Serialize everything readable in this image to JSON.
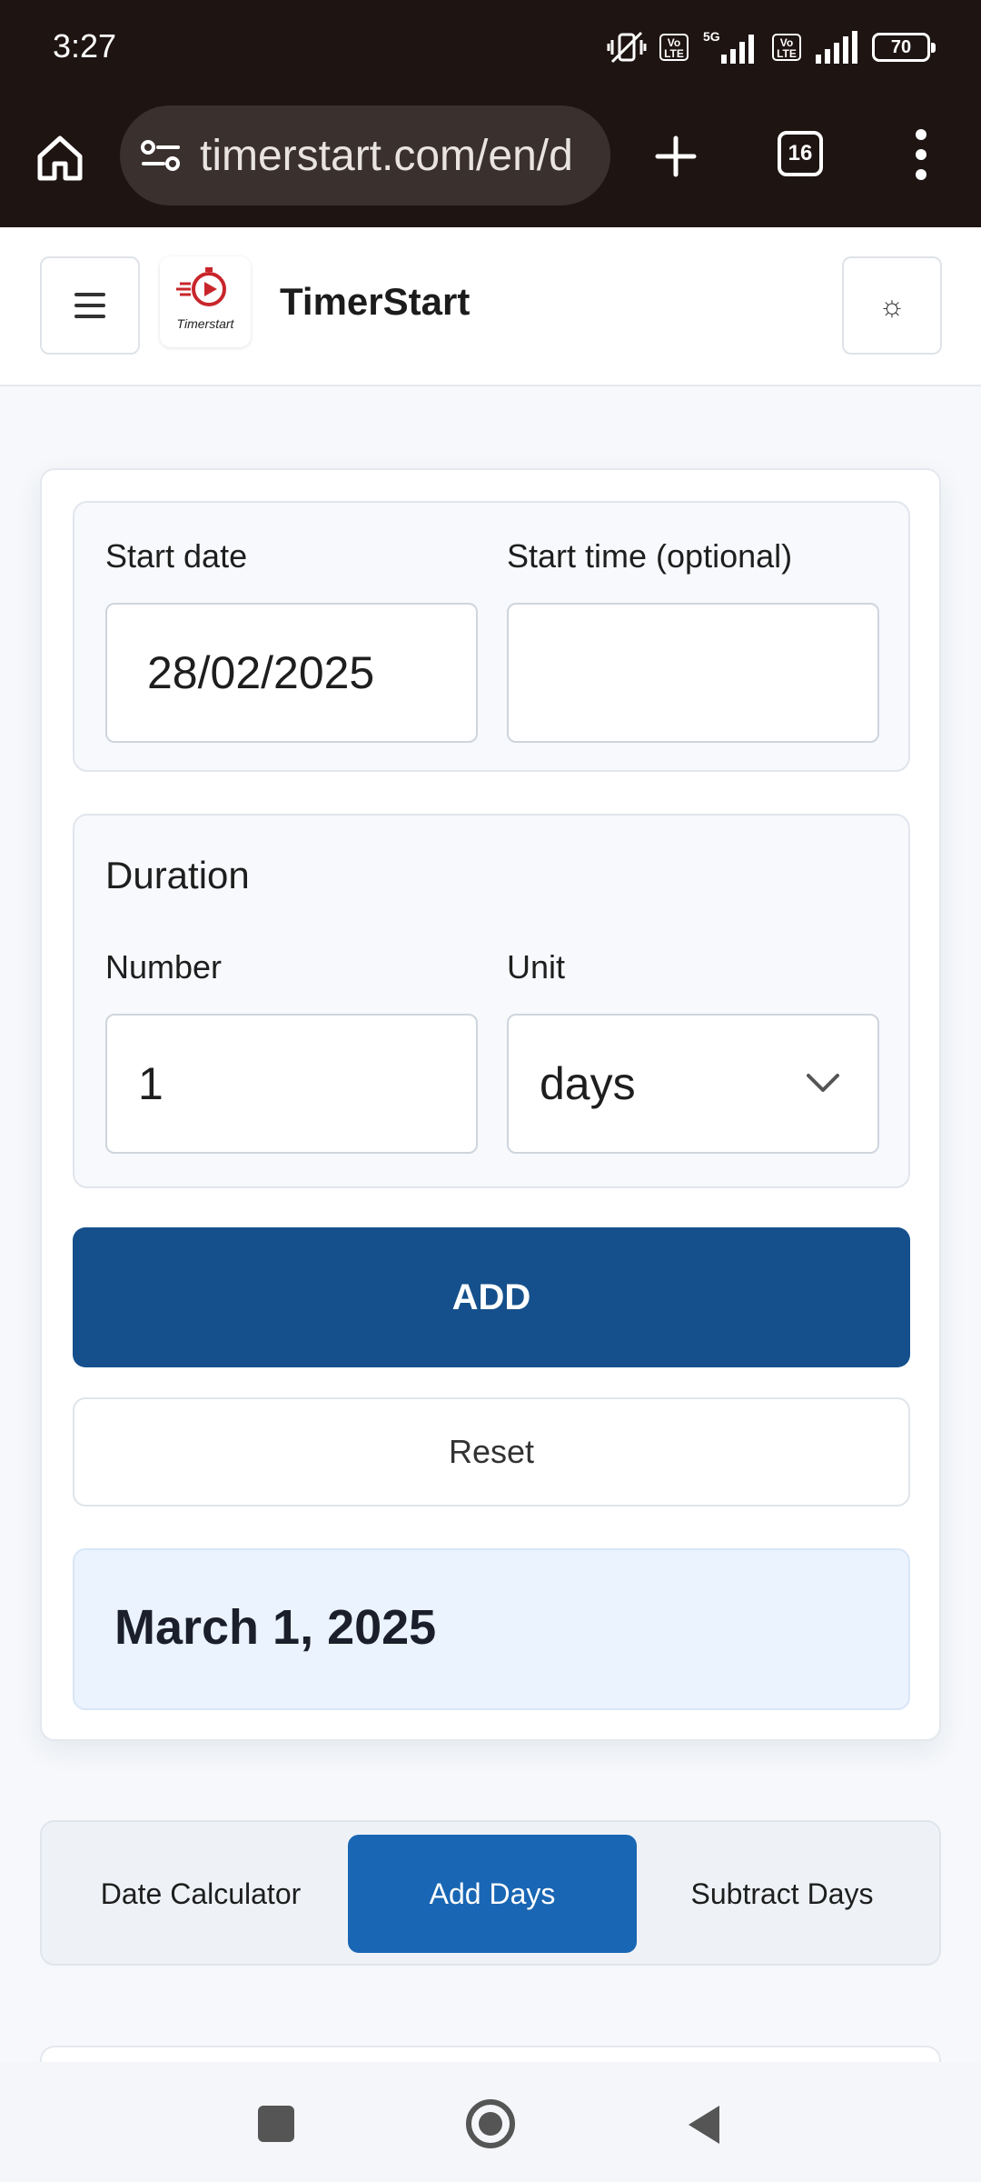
{
  "status_bar": {
    "time": "3:27",
    "network": "5G",
    "volte_label": "Vo LTE",
    "battery": "70"
  },
  "browser": {
    "url": "timerstart.com/en/d",
    "tab_count": "16"
  },
  "header": {
    "site_title": "TimerStart",
    "logo_text": "Timerstart",
    "theme_icon": "☼"
  },
  "form": {
    "start_date_label": "Start date",
    "start_date_value": "28/02/2025",
    "start_time_label": "Start time (optional)",
    "start_time_value": "",
    "duration_title": "Duration",
    "number_label": "Number",
    "number_value": "1",
    "unit_label": "Unit",
    "unit_value": "days",
    "add_label": "ADD",
    "reset_label": "Reset",
    "result": "March 1, 2025"
  },
  "tabs": [
    {
      "label": "Date Calculator",
      "active": false
    },
    {
      "label": "Add Days",
      "active": true
    },
    {
      "label": "Subtract Days",
      "active": false
    }
  ],
  "colors": {
    "primary_button": "#15508c",
    "active_tab": "#1966b4",
    "result_bg": "#eaf3fe",
    "browser_chrome": "#1e1412"
  }
}
